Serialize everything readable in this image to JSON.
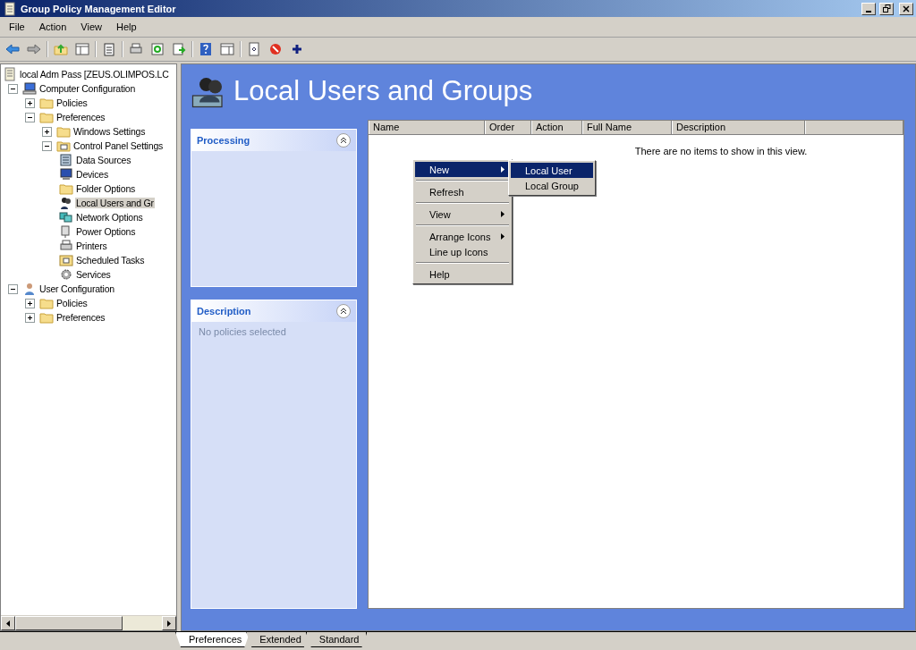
{
  "window": {
    "title": "Group Policy Management Editor"
  },
  "menu_bar": [
    "File",
    "Action",
    "View",
    "Help"
  ],
  "tree": [
    {
      "label": "local Adm Pass [ZEUS.OLIMPOS.LC",
      "kind": "policy",
      "selected": false,
      "children": [
        {
          "label": "Computer Configuration",
          "kind": "computer",
          "expanded": true,
          "selected": false,
          "children": [
            {
              "label": "Policies",
              "kind": "folder",
              "expanded": false,
              "selected": false
            },
            {
              "label": "Preferences",
              "kind": "folder",
              "expanded": true,
              "selected": false,
              "children": [
                {
                  "label": "Windows Settings",
                  "kind": "folder",
                  "expanded": false,
                  "selected": false
                },
                {
                  "label": "Control Panel Settings",
                  "kind": "panel",
                  "expanded": true,
                  "selected": false,
                  "children": [
                    {
                      "label": "Data Sources",
                      "kind": "data",
                      "selected": false
                    },
                    {
                      "label": "Devices",
                      "kind": "device",
                      "selected": false
                    },
                    {
                      "label": "Folder Options",
                      "kind": "folder",
                      "selected": false
                    },
                    {
                      "label": "Local Users and Gr",
                      "kind": "users",
                      "selected": true
                    },
                    {
                      "label": "Network Options",
                      "kind": "network",
                      "selected": false
                    },
                    {
                      "label": "Power Options",
                      "kind": "power",
                      "selected": false
                    },
                    {
                      "label": "Printers",
                      "kind": "printer",
                      "selected": false
                    },
                    {
                      "label": "Scheduled Tasks",
                      "kind": "task",
                      "selected": false
                    },
                    {
                      "label": "Services",
                      "kind": "gear",
                      "selected": false
                    }
                  ]
                }
              ]
            }
          ]
        },
        {
          "label": "User Configuration",
          "kind": "user",
          "expanded": true,
          "selected": false,
          "children": [
            {
              "label": "Policies",
              "kind": "folder",
              "expanded": false,
              "selected": false
            },
            {
              "label": "Preferences",
              "kind": "folder",
              "expanded": false,
              "selected": false
            }
          ]
        }
      ]
    }
  ],
  "header": {
    "title": "Local Users and Groups"
  },
  "panels": [
    {
      "title": "Processing",
      "expanded": true
    },
    {
      "title": "Description",
      "expanded": true,
      "text": "No policies selected"
    }
  ],
  "table": {
    "columns": [
      "Name",
      "Order",
      "Action",
      "Full Name",
      "Description"
    ],
    "empty_text": "There are no items to show in this view."
  },
  "context_menu": [
    {
      "kind": "item",
      "label": "New",
      "submenu": true,
      "selected": true
    },
    {
      "kind": "separator"
    },
    {
      "kind": "item",
      "label": "Refresh",
      "submenu": false,
      "selected": false
    },
    {
      "kind": "separator"
    },
    {
      "kind": "item",
      "label": "View",
      "submenu": true,
      "selected": false
    },
    {
      "kind": "separator"
    },
    {
      "kind": "item",
      "label": "Arrange Icons",
      "submenu": true,
      "selected": false
    },
    {
      "kind": "item",
      "label": "Line up Icons",
      "submenu": false,
      "selected": false
    },
    {
      "kind": "separator"
    },
    {
      "kind": "item",
      "label": "Help",
      "submenu": false,
      "selected": false
    }
  ],
  "submenu": [
    {
      "label": "Local User",
      "selected": true
    },
    {
      "label": "Local Group",
      "selected": false
    }
  ],
  "tabs": [
    {
      "label": "Preferences",
      "selected": true
    },
    {
      "label": "Extended",
      "selected": false
    },
    {
      "label": "Standard",
      "selected": false
    }
  ]
}
